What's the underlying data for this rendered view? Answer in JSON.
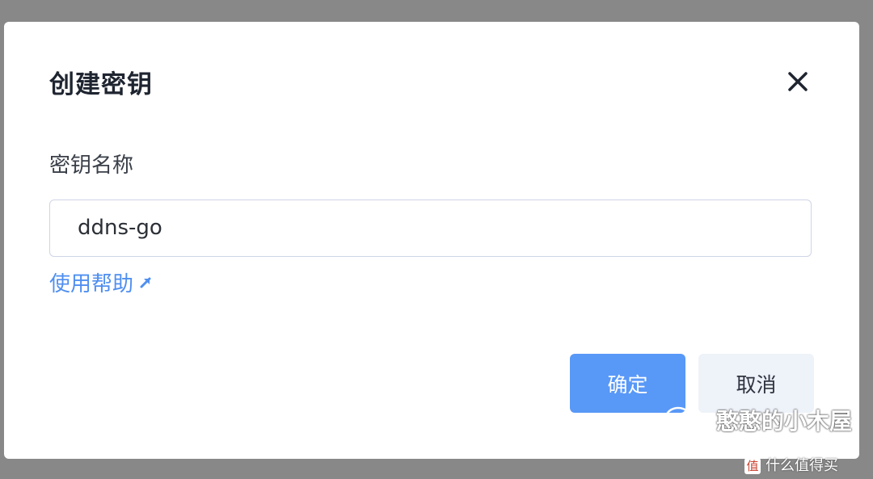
{
  "dialog": {
    "title": "创建密钥",
    "field_label": "密钥名称",
    "input_value": "ddns-go",
    "help_link": "使用帮助",
    "confirm_label": "确定",
    "cancel_label": "取消"
  },
  "watermark": {
    "primary": "憨憨的小木屋",
    "secondary_badge": "值",
    "secondary": "什么值得买"
  },
  "colors": {
    "primary": "#5898f7",
    "link": "#4f8ff0",
    "secondary_bg": "#eef2f9"
  }
}
